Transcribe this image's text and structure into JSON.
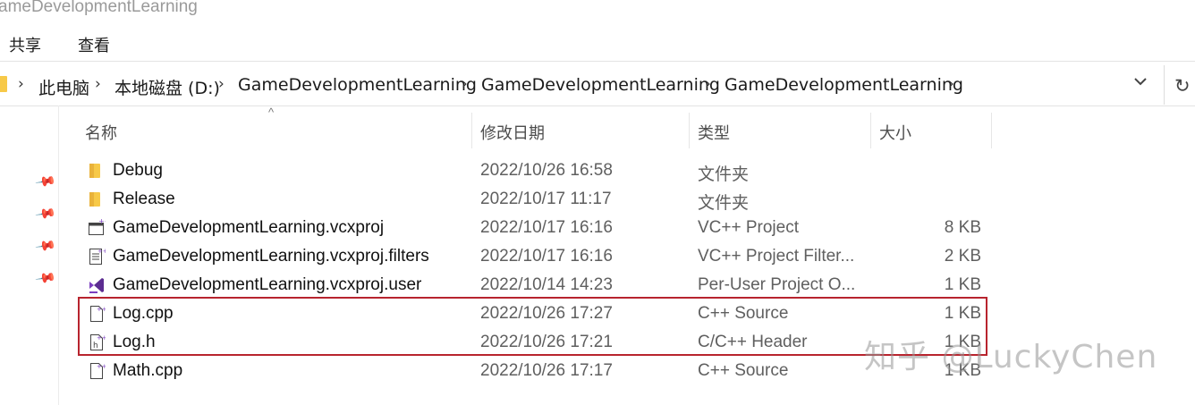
{
  "window": {
    "title": "ameDevelopmentLearning"
  },
  "ribbon": {
    "tabs": [
      "共享",
      "查看"
    ]
  },
  "address": {
    "crumbs": [
      "此电脑",
      "本地磁盘 (D:)",
      "GameDevelopmentLearning",
      "GameDevelopmentLearning",
      "GameDevelopmentLearning"
    ]
  },
  "columns": {
    "name": "名称",
    "date": "修改日期",
    "type": "类型",
    "size": "大小"
  },
  "files": [
    {
      "name": "Debug",
      "date": "2022/10/26 16:58",
      "type": "文件夹",
      "size": "",
      "icon": "folder-icon"
    },
    {
      "name": "Release",
      "date": "2022/10/17 11:17",
      "type": "文件夹",
      "size": "",
      "icon": "folder-icon"
    },
    {
      "name": "GameDevelopmentLearning.vcxproj",
      "date": "2022/10/17 16:16",
      "type": "VC++ Project",
      "size": "8 KB",
      "icon": "vcxproj-icon"
    },
    {
      "name": "GameDevelopmentLearning.vcxproj.filters",
      "date": "2022/10/17 16:16",
      "type": "VC++ Project Filter...",
      "size": "2 KB",
      "icon": "filters-icon"
    },
    {
      "name": "GameDevelopmentLearning.vcxproj.user",
      "date": "2022/10/14 14:23",
      "type": "Per-User Project O...",
      "size": "1 KB",
      "icon": "visual-studio-icon"
    },
    {
      "name": "Log.cpp",
      "date": "2022/10/26 17:27",
      "type": "C++ Source",
      "size": "1 KB",
      "icon": "cpp-file-icon"
    },
    {
      "name": "Log.h",
      "date": "2022/10/26 17:21",
      "type": "C/C++ Header",
      "size": "1 KB",
      "icon": "header-file-icon"
    },
    {
      "name": "Math.cpp",
      "date": "2022/10/26 17:17",
      "type": "C++ Source",
      "size": "1 KB",
      "icon": "cpp-file-icon"
    }
  ],
  "watermark": "知乎 @LuckyChen",
  "colors": {
    "folder": "#f7c948",
    "highlight_box": "#b8242e",
    "vs_purple": "#7b3fbf"
  }
}
